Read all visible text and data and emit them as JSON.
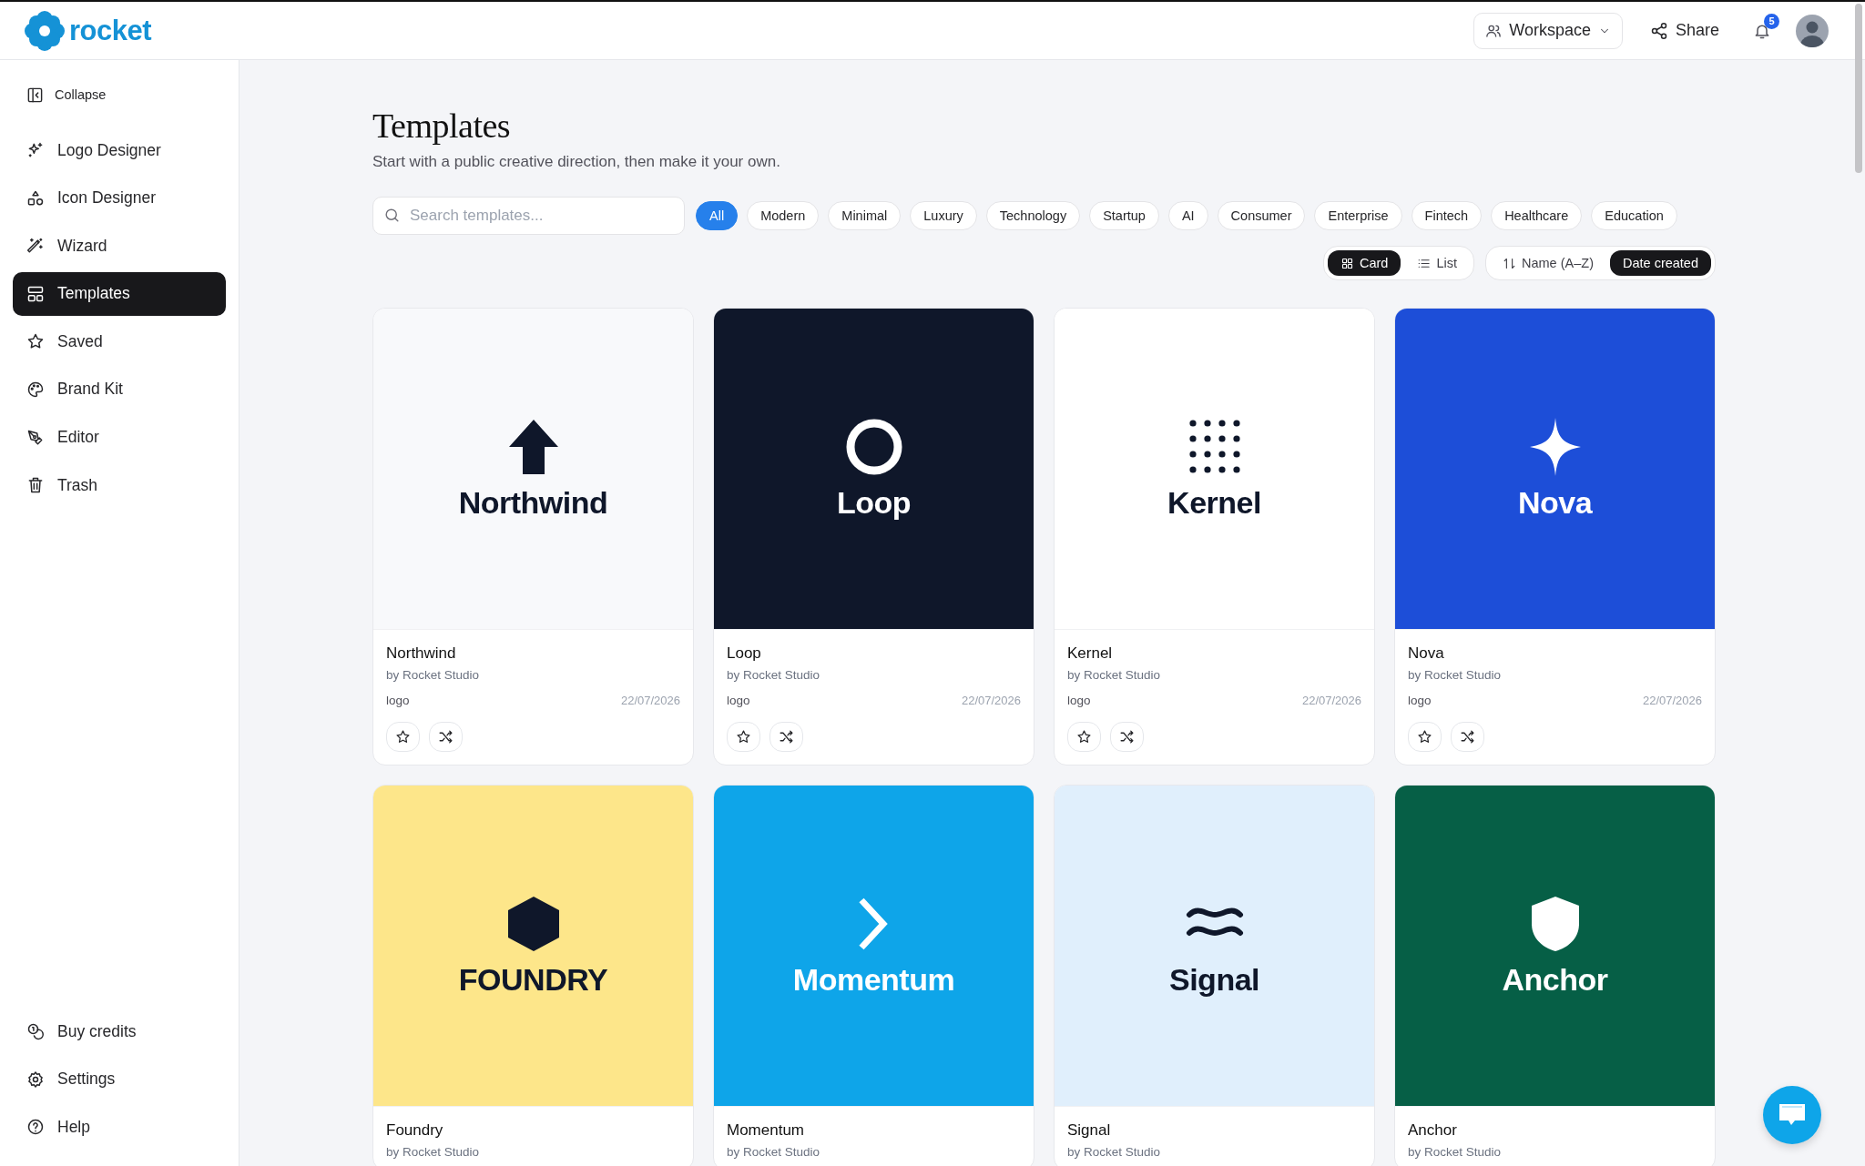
{
  "brand": {
    "name": "rocket"
  },
  "topbar": {
    "workspace": "Workspace",
    "share": "Share",
    "notifications": "5"
  },
  "sidebar": {
    "collapse": "Collapse",
    "items": [
      {
        "label": "Logo Designer",
        "selected": false
      },
      {
        "label": "Icon Designer",
        "selected": false
      },
      {
        "label": "Wizard",
        "selected": false
      },
      {
        "label": "Templates",
        "selected": true
      },
      {
        "label": "Saved",
        "selected": false
      },
      {
        "label": "Brand Kit",
        "selected": false
      },
      {
        "label": "Editor",
        "selected": false
      },
      {
        "label": "Trash",
        "selected": false
      }
    ],
    "footer": [
      {
        "label": "Buy credits"
      },
      {
        "label": "Settings"
      },
      {
        "label": "Help"
      }
    ]
  },
  "page": {
    "title": "Templates",
    "subtitle": "Start with a public creative direction, then make it your own.",
    "search": {
      "placeholder": "Search templates..."
    }
  },
  "filters": [
    {
      "label": "All",
      "selected": true
    },
    {
      "label": "Modern",
      "selected": false
    },
    {
      "label": "Minimal",
      "selected": false
    },
    {
      "label": "Luxury",
      "selected": false
    },
    {
      "label": "Technology",
      "selected": false
    },
    {
      "label": "Startup",
      "selected": false
    },
    {
      "label": "AI",
      "selected": false
    },
    {
      "label": "Consumer",
      "selected": false
    },
    {
      "label": "Enterprise",
      "selected": false
    },
    {
      "label": "Fintech",
      "selected": false
    },
    {
      "label": "Healthcare",
      "selected": false
    },
    {
      "label": "Education",
      "selected": false
    }
  ],
  "view": [
    {
      "label": "Card",
      "selected": true
    },
    {
      "label": "List",
      "selected": false
    }
  ],
  "sort": [
    {
      "label": "Name (A–Z)",
      "selected": false
    },
    {
      "label": "Date created",
      "selected": true
    }
  ],
  "cards": [
    {
      "name": "Northwind",
      "author": "by Rocket Studio",
      "type": "logo",
      "date": "22/07/2026",
      "preview": {
        "wordmark": "Northwind",
        "color": "#f8f9fb"
      }
    },
    {
      "name": "Loop",
      "author": "by Rocket Studio",
      "type": "logo",
      "date": "22/07/2026",
      "preview": {
        "wordmark": "Loop",
        "color": "#0f172a"
      }
    },
    {
      "name": "Kernel",
      "author": "by Rocket Studio",
      "type": "logo",
      "date": "22/07/2026",
      "preview": {
        "wordmark": "Kernel",
        "color": "#ffffff"
      }
    },
    {
      "name": "Nova",
      "author": "by Rocket Studio",
      "type": "logo",
      "date": "22/07/2026",
      "preview": {
        "wordmark": "Nova",
        "color": "#1d4ed8"
      }
    },
    {
      "name": "Foundry",
      "author": "by Rocket Studio",
      "preview": {
        "wordmark": "FOUNDRY",
        "color": "#fde68a"
      }
    },
    {
      "name": "Momentum",
      "author": "by Rocket Studio",
      "preview": {
        "wordmark": "Momentum",
        "color": "#0ea5e9"
      }
    },
    {
      "name": "Signal",
      "author": "by Rocket Studio",
      "preview": {
        "wordmark": "Signal",
        "color": "#e0effc"
      }
    },
    {
      "name": "Anchor",
      "author": "by Rocket Studio",
      "preview": {
        "wordmark": "Anchor",
        "color": "#065f46"
      }
    }
  ]
}
